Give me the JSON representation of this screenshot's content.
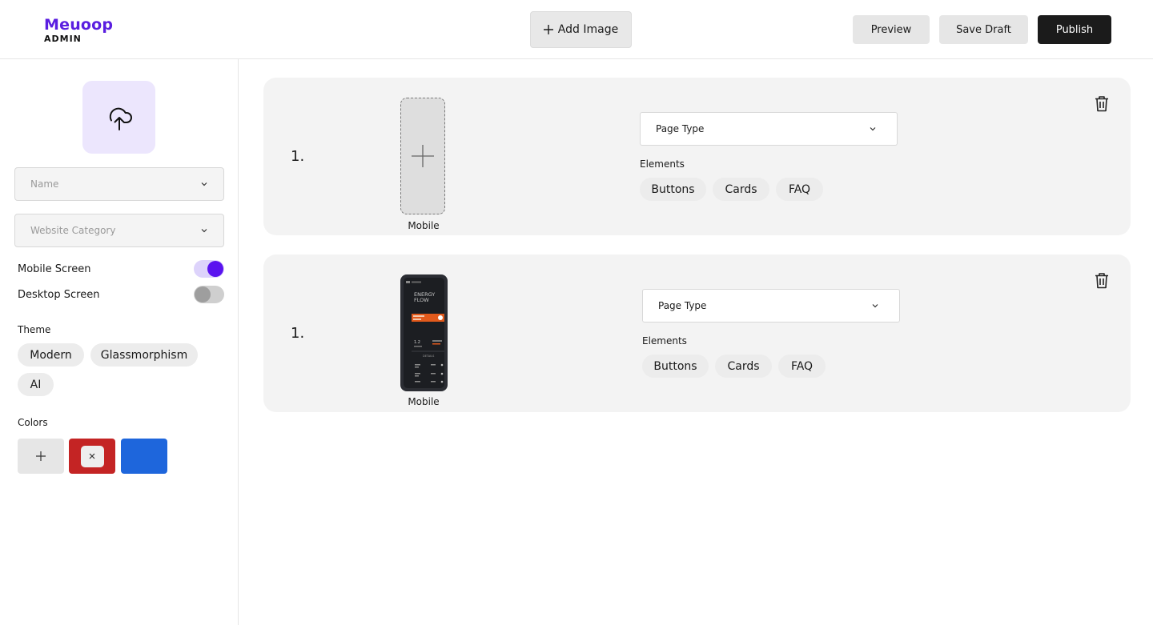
{
  "brand": {
    "name": "Meuoop",
    "sub": "ADMIN",
    "color": "#5a1ee0"
  },
  "header": {
    "add_image_label": "Add Image",
    "preview_label": "Preview",
    "save_draft_label": "Save Draft",
    "publish_label": "Publish"
  },
  "sidebar": {
    "name_placeholder": "Name",
    "category_placeholder": "Website Category",
    "toggles": [
      {
        "label": "Mobile Screen",
        "on": true
      },
      {
        "label": "Desktop Screen",
        "on": false
      }
    ],
    "theme_label": "Theme",
    "themes": [
      "Modern",
      "Glassmorphism",
      "AI"
    ],
    "colors_label": "Colors",
    "colors": [
      "#c42424",
      "#1e66dc"
    ]
  },
  "cards": [
    {
      "number": "1.",
      "caption": "Mobile",
      "page_type": "Page Type",
      "elements_label": "Elements",
      "elements": [
        "Buttons",
        "Cards",
        "FAQ"
      ]
    },
    {
      "number": "1.",
      "caption": "Mobile",
      "page_type": "Page Type",
      "elements_label": "Elements",
      "elements": [
        "Buttons",
        "Cards",
        "FAQ"
      ],
      "preview_title": "ENERGY FLOW",
      "preview_subtitle": "DETAILS"
    }
  ]
}
